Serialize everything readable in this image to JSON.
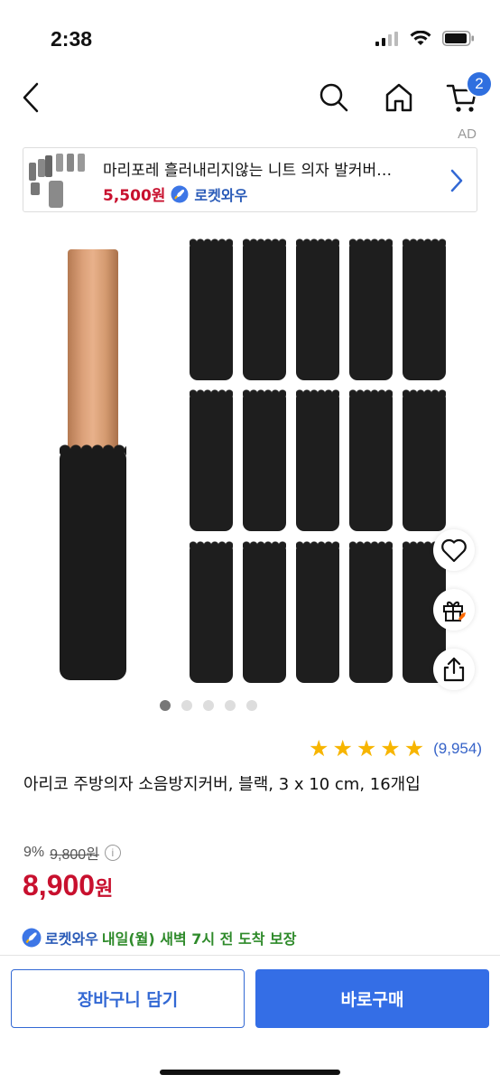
{
  "status_bar": {
    "time": "2:38"
  },
  "nav": {
    "cart_badge": "2"
  },
  "ad": {
    "label": "AD",
    "title": "마리포레 흘러내리지않는 니트 의자 발커버…",
    "price": "5,500원",
    "rocket": "로켓와우"
  },
  "gallery": {
    "total_images": 5,
    "active_index": 0
  },
  "rating": {
    "stars": 5,
    "reviews": "(9,954)"
  },
  "product": {
    "title": "아리코 주방의자 소음방지커버, 블랙, 3 x 10 cm, 16개입",
    "discount": "9%",
    "original_price": "9,800원",
    "price_value": "8,900",
    "price_unit": "원"
  },
  "delivery": {
    "rocket": "로켓와우",
    "text": "내일(월) 새벽 7시 전 도착 보장"
  },
  "buttons": {
    "cart": "장바구니 담기",
    "buy": "바로구매"
  },
  "colors": {
    "accent": "#346ee6",
    "price": "#c8102e",
    "delivery": "#2e8a2a",
    "star": "#f7b500"
  }
}
